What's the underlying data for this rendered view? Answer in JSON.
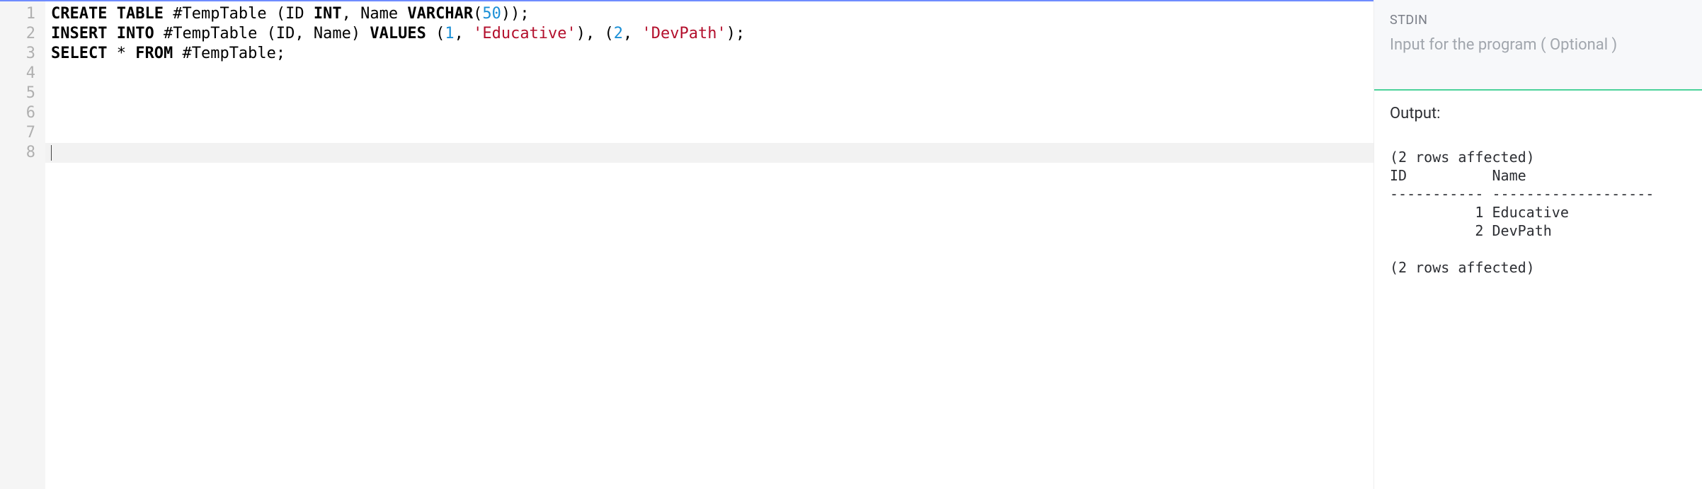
{
  "editor": {
    "line_numbers": [
      "1",
      "2",
      "3",
      "4",
      "5",
      "6",
      "7",
      "8"
    ],
    "lines": [
      [
        {
          "cls": "kw",
          "t": "CREATE"
        },
        {
          "cls": "",
          "t": " "
        },
        {
          "cls": "kw",
          "t": "TABLE"
        },
        {
          "cls": "",
          "t": " #TempTable ("
        },
        {
          "cls": "",
          "t": "ID "
        },
        {
          "cls": "kw",
          "t": "INT"
        },
        {
          "cls": "",
          "t": ", Name "
        },
        {
          "cls": "kw",
          "t": "VARCHAR"
        },
        {
          "cls": "",
          "t": "("
        },
        {
          "cls": "num",
          "t": "50"
        },
        {
          "cls": "",
          "t": "));"
        }
      ],
      [
        {
          "cls": "kw",
          "t": "INSERT"
        },
        {
          "cls": "",
          "t": " "
        },
        {
          "cls": "kw",
          "t": "INTO"
        },
        {
          "cls": "",
          "t": " #TempTable (ID, Name) "
        },
        {
          "cls": "kw",
          "t": "VALUES"
        },
        {
          "cls": "",
          "t": " ("
        },
        {
          "cls": "num",
          "t": "1"
        },
        {
          "cls": "",
          "t": ", "
        },
        {
          "cls": "str",
          "t": "'Educative'"
        },
        {
          "cls": "",
          "t": "), ("
        },
        {
          "cls": "num",
          "t": "2"
        },
        {
          "cls": "",
          "t": ", "
        },
        {
          "cls": "str",
          "t": "'DevPath'"
        },
        {
          "cls": "",
          "t": ");"
        }
      ],
      [
        {
          "cls": "kw",
          "t": "SELECT"
        },
        {
          "cls": "",
          "t": " * "
        },
        {
          "cls": "kw",
          "t": "FROM"
        },
        {
          "cls": "",
          "t": " #TempTable;"
        }
      ],
      [],
      [],
      [],
      [],
      []
    ],
    "current_line_index": 7
  },
  "stdin": {
    "label": "STDIN",
    "placeholder": "Input for the program ( Optional )",
    "value": ""
  },
  "output": {
    "label": "Output:",
    "text": "(2 rows affected)\nID          Name\n----------- -------------------\n          1 Educative\n          2 DevPath\n\n(2 rows affected)"
  }
}
